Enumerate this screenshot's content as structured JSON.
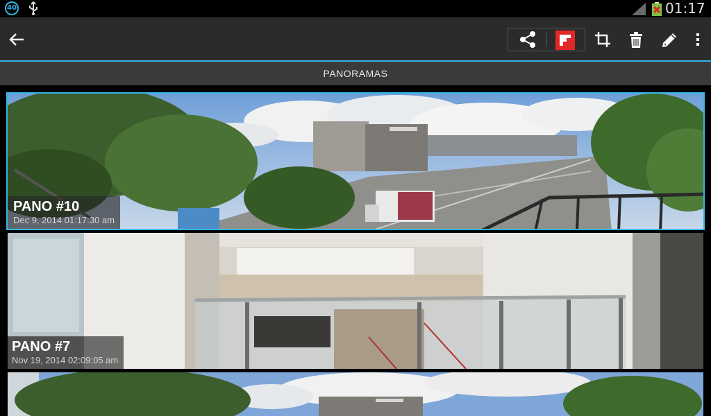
{
  "status_bar": {
    "notification_count": "40",
    "time": "01:17"
  },
  "action_bar": {
    "icons": [
      "back-arrow-icon",
      "share-icon",
      "flipboard-icon",
      "crop-icon",
      "trash-icon",
      "pencil-icon",
      "overflow-menu-icon"
    ]
  },
  "section": {
    "title": "PANORAMAS"
  },
  "panoramas": [
    {
      "title": "PANO #10",
      "date": "Dec 9, 2014 01:17:30 am",
      "selected": true
    },
    {
      "title": "PANO #7",
      "date": "Nov 19, 2014 02:09:05 am",
      "selected": false
    },
    {
      "title": "",
      "date": "",
      "selected": false
    }
  ],
  "colors": {
    "accent": "#33b5e5",
    "action_bar": "#2b2b2b",
    "header_bar": "#3a3a3a",
    "flipboard_red": "#e12828"
  }
}
